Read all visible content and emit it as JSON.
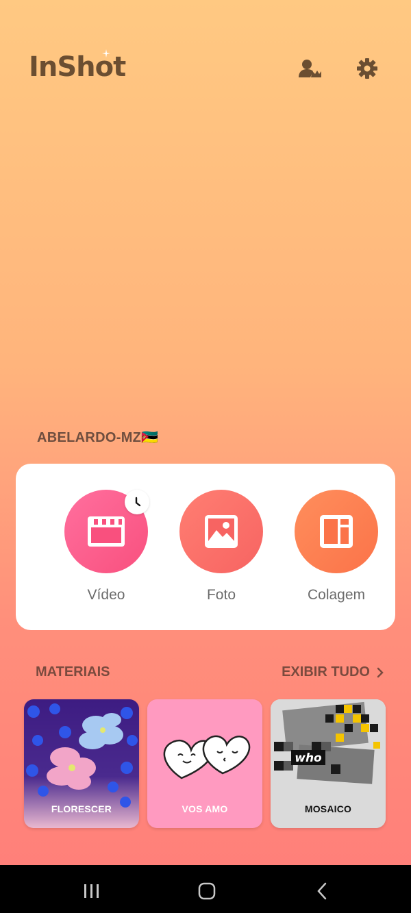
{
  "app": {
    "logo_text": "InShot"
  },
  "header": {
    "account_icon": "account-crown-icon",
    "settings_icon": "gear-icon"
  },
  "user": {
    "name": "ABELARDO-MZ🇲🇿"
  },
  "tools": [
    {
      "label": "Vídeo",
      "icon": "clapperboard-icon",
      "color": "#F9507E"
    },
    {
      "label": "Foto",
      "icon": "image-icon",
      "color": "#F76462"
    },
    {
      "label": "Colagem",
      "icon": "collage-layout-icon",
      "color": "#FB7349"
    }
  ],
  "materials": {
    "title": "MATERIAIS",
    "view_all": "EXIBIR TUDO",
    "items": [
      {
        "label": "FLORESCER"
      },
      {
        "label": "VOS AMO"
      },
      {
        "label": "MOSAICO",
        "sticker_text": "who"
      }
    ]
  },
  "nav": {
    "recents": "recents-icon",
    "home": "home-icon",
    "back": "back-icon"
  }
}
